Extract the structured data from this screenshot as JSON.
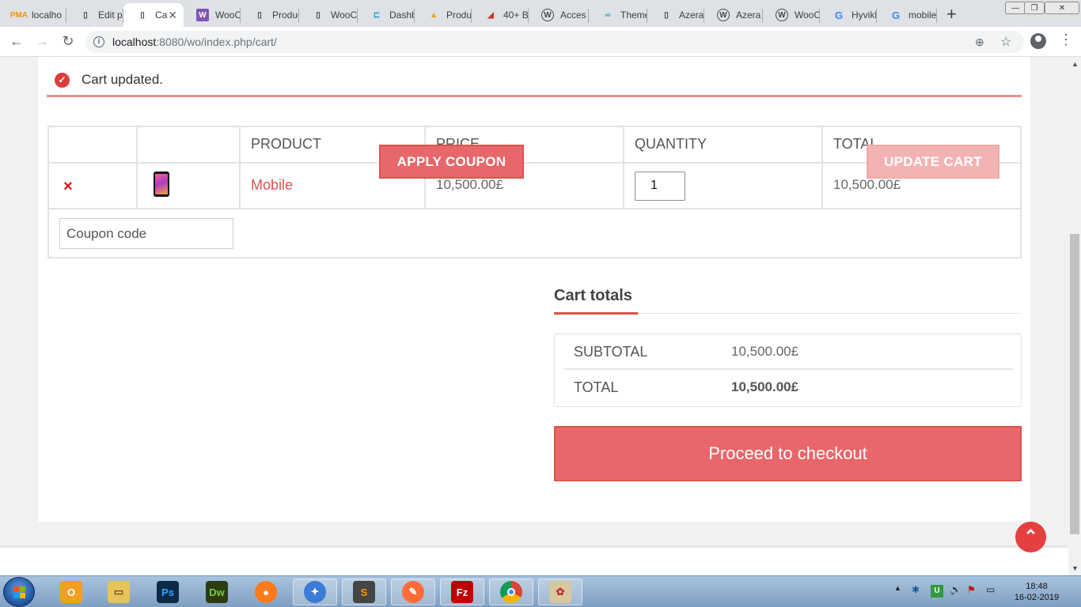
{
  "browser": {
    "tabs": [
      {
        "label": "localho",
        "icon": "phpmyadmin-icon"
      },
      {
        "label": "Edit pr",
        "icon": "page-icon"
      },
      {
        "label": "Ca",
        "icon": "page-icon",
        "active": true
      },
      {
        "label": "WooCo",
        "icon": "woocommerce-icon"
      },
      {
        "label": "Produc",
        "icon": "page-icon"
      },
      {
        "label": "WooCo",
        "icon": "page-icon"
      },
      {
        "label": "Dashb",
        "icon": "dashboard-icon"
      },
      {
        "label": "Produc",
        "icon": "graduation-cap-icon"
      },
      {
        "label": "40+ Be",
        "icon": "logo-icon"
      },
      {
        "label": "Acces",
        "icon": "wordpress-icon"
      },
      {
        "label": "Theme",
        "icon": "link-icon"
      },
      {
        "label": "Azera",
        "icon": "page-icon"
      },
      {
        "label": "Azera",
        "icon": "wordpress-icon"
      },
      {
        "label": "WooCo",
        "icon": "wordpress-icon"
      },
      {
        "label": "Hyvikk",
        "icon": "google-icon"
      },
      {
        "label": "mobile",
        "icon": "google-icon"
      }
    ],
    "url_host": "localhost",
    "url_rest": ":8080/wo/index.php/cart/"
  },
  "notice": {
    "message": "Cart updated."
  },
  "cart": {
    "headers": [
      "",
      "",
      "PRODUCT",
      "PRICE",
      "QUANTITY",
      "TOTAL"
    ],
    "item": {
      "remove": "×",
      "name": "Mobile",
      "price": "10,500.00£",
      "quantity": "1",
      "total": "10,500.00£"
    },
    "coupon_placeholder": "Coupon code",
    "apply_coupon": "APPLY COUPON",
    "update_cart": "UPDATE CART"
  },
  "totals": {
    "title": "Cart totals",
    "subtotal_label": "SUBTOTAL",
    "subtotal_value": "10,500.00£",
    "total_label": "TOTAL",
    "total_value": "10,500.00£",
    "checkout": "Proceed to checkout"
  },
  "taskbar": {
    "time": "18:48",
    "date": "16-02-2019",
    "apps": [
      "outlook-icon",
      "explorer-icon",
      "photoshop-icon",
      "dreamweaver-icon",
      "firefox-icon",
      "messenger-icon",
      "sublime-icon",
      "postman-icon",
      "filezilla-icon",
      "chrome-icon",
      "paint-icon"
    ]
  },
  "colors": {
    "accent": "#d9534f",
    "button_fill": "#e8676a",
    "button_disabled": "#f3b3b2"
  }
}
